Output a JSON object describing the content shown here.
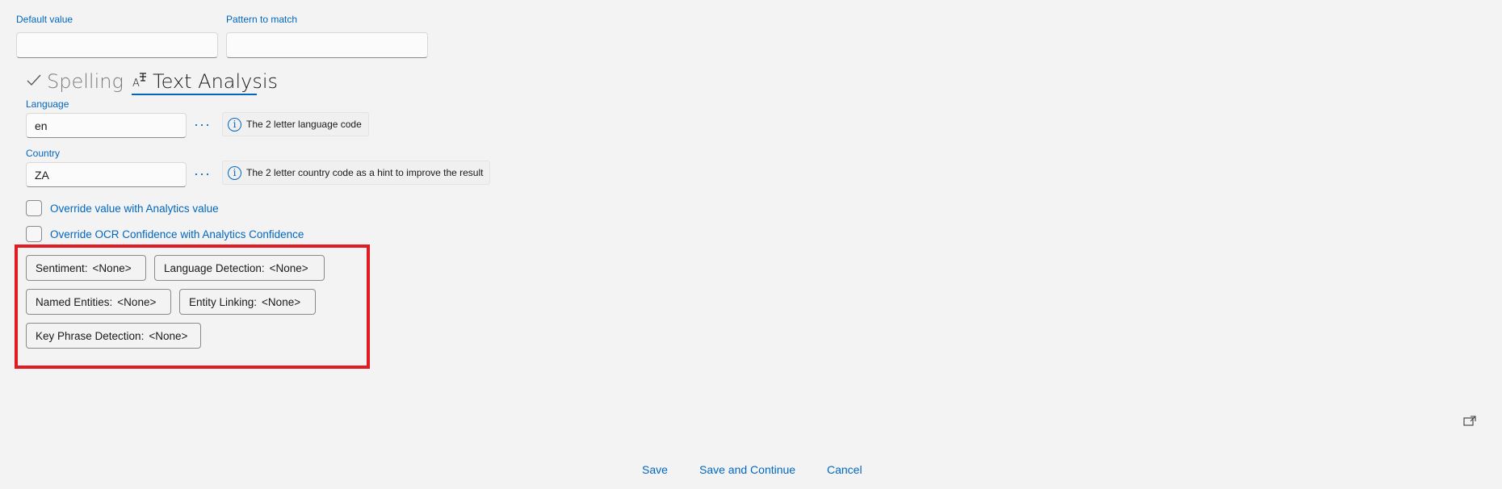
{
  "form": {
    "default_value_label": "Default value",
    "default_value": "",
    "pattern_label": "Pattern to match",
    "pattern_value": ""
  },
  "tabs": {
    "spelling_label": "Spelling",
    "text_analysis_label": "Text Analysis",
    "active": "Text Analysis"
  },
  "language": {
    "label": "Language",
    "value": "en",
    "more_label": "···",
    "hint": "The 2 letter language code"
  },
  "country": {
    "label": "Country",
    "value": "ZA",
    "more_label": "···",
    "hint": "The 2 letter country code as a hint to improve the result"
  },
  "options": {
    "override_value_label": "Override value with Analytics value",
    "override_value_checked": false,
    "override_confidence_label": "Override OCR Confidence with Analytics Confidence",
    "override_confidence_checked": false
  },
  "analysis_buttons": {
    "sentiment_label": "Sentiment:",
    "sentiment_value": "<None>",
    "language_detection_label": "Language Detection:",
    "language_detection_value": "<None>",
    "named_entities_label": "Named Entities:",
    "named_entities_value": "<None>",
    "entity_linking_label": "Entity Linking:",
    "entity_linking_value": "<None>",
    "key_phrase_label": "Key Phrase Detection:",
    "key_phrase_value": "<None>"
  },
  "footer": {
    "save_label": "Save",
    "save_continue_label": "Save and Continue",
    "cancel_label": "Cancel"
  },
  "icons": {
    "info": "info-circle-icon",
    "spelling": "checkmark-icon",
    "text_analysis": "text-analysis-icon",
    "popout": "popout-icon"
  },
  "colors": {
    "accent": "#0067c0",
    "highlight": "#e21b23",
    "background": "#f3f3f3"
  }
}
